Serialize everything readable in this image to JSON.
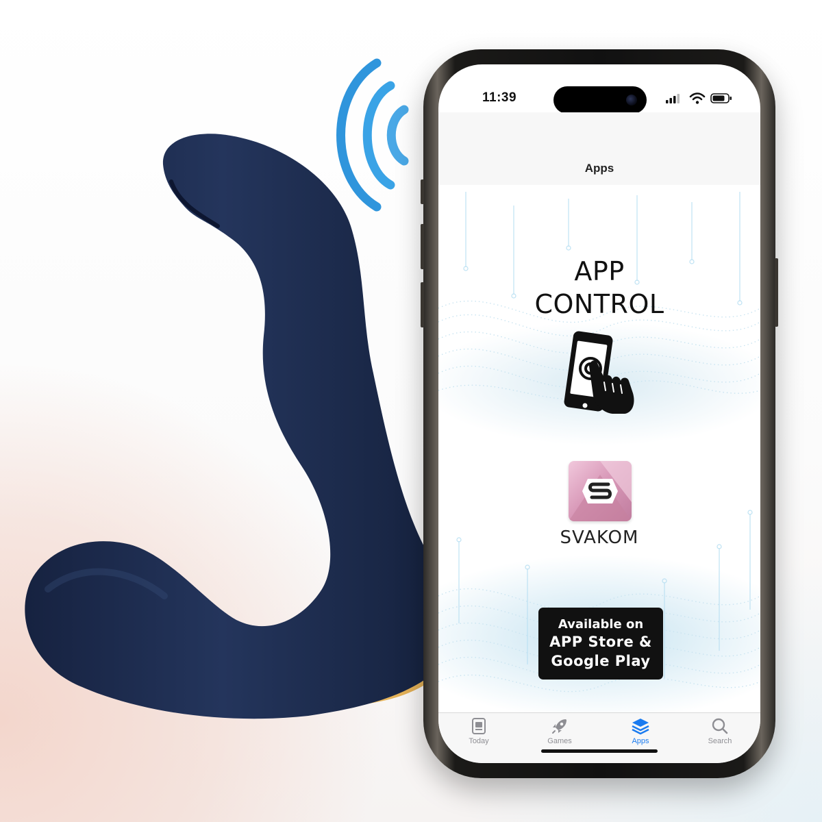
{
  "phone": {
    "status_bar": {
      "time": "11:39"
    },
    "nav_title": "Apps",
    "content": {
      "headline_line1": "APP",
      "headline_line2": "CONTROL",
      "brand_name": "SVAKOM",
      "badge_line1": "Available on",
      "badge_line2": "APP Store &",
      "badge_line3": "Google Play"
    },
    "tab_bar": {
      "tabs": [
        {
          "label": "Today",
          "icon": "today-icon",
          "active": false
        },
        {
          "label": "Games",
          "icon": "rocket-icon",
          "active": false
        },
        {
          "label": "Apps",
          "icon": "stack-icon",
          "active": true
        },
        {
          "label": "Search",
          "icon": "search-icon",
          "active": false
        }
      ]
    }
  },
  "colors": {
    "device_navy": "#1d2a4a",
    "device_gold": "#e0a84a",
    "signal_blue": "#3aa3e6",
    "tab_active": "#1a7bf0",
    "logo_pink": "#d99ab9"
  }
}
